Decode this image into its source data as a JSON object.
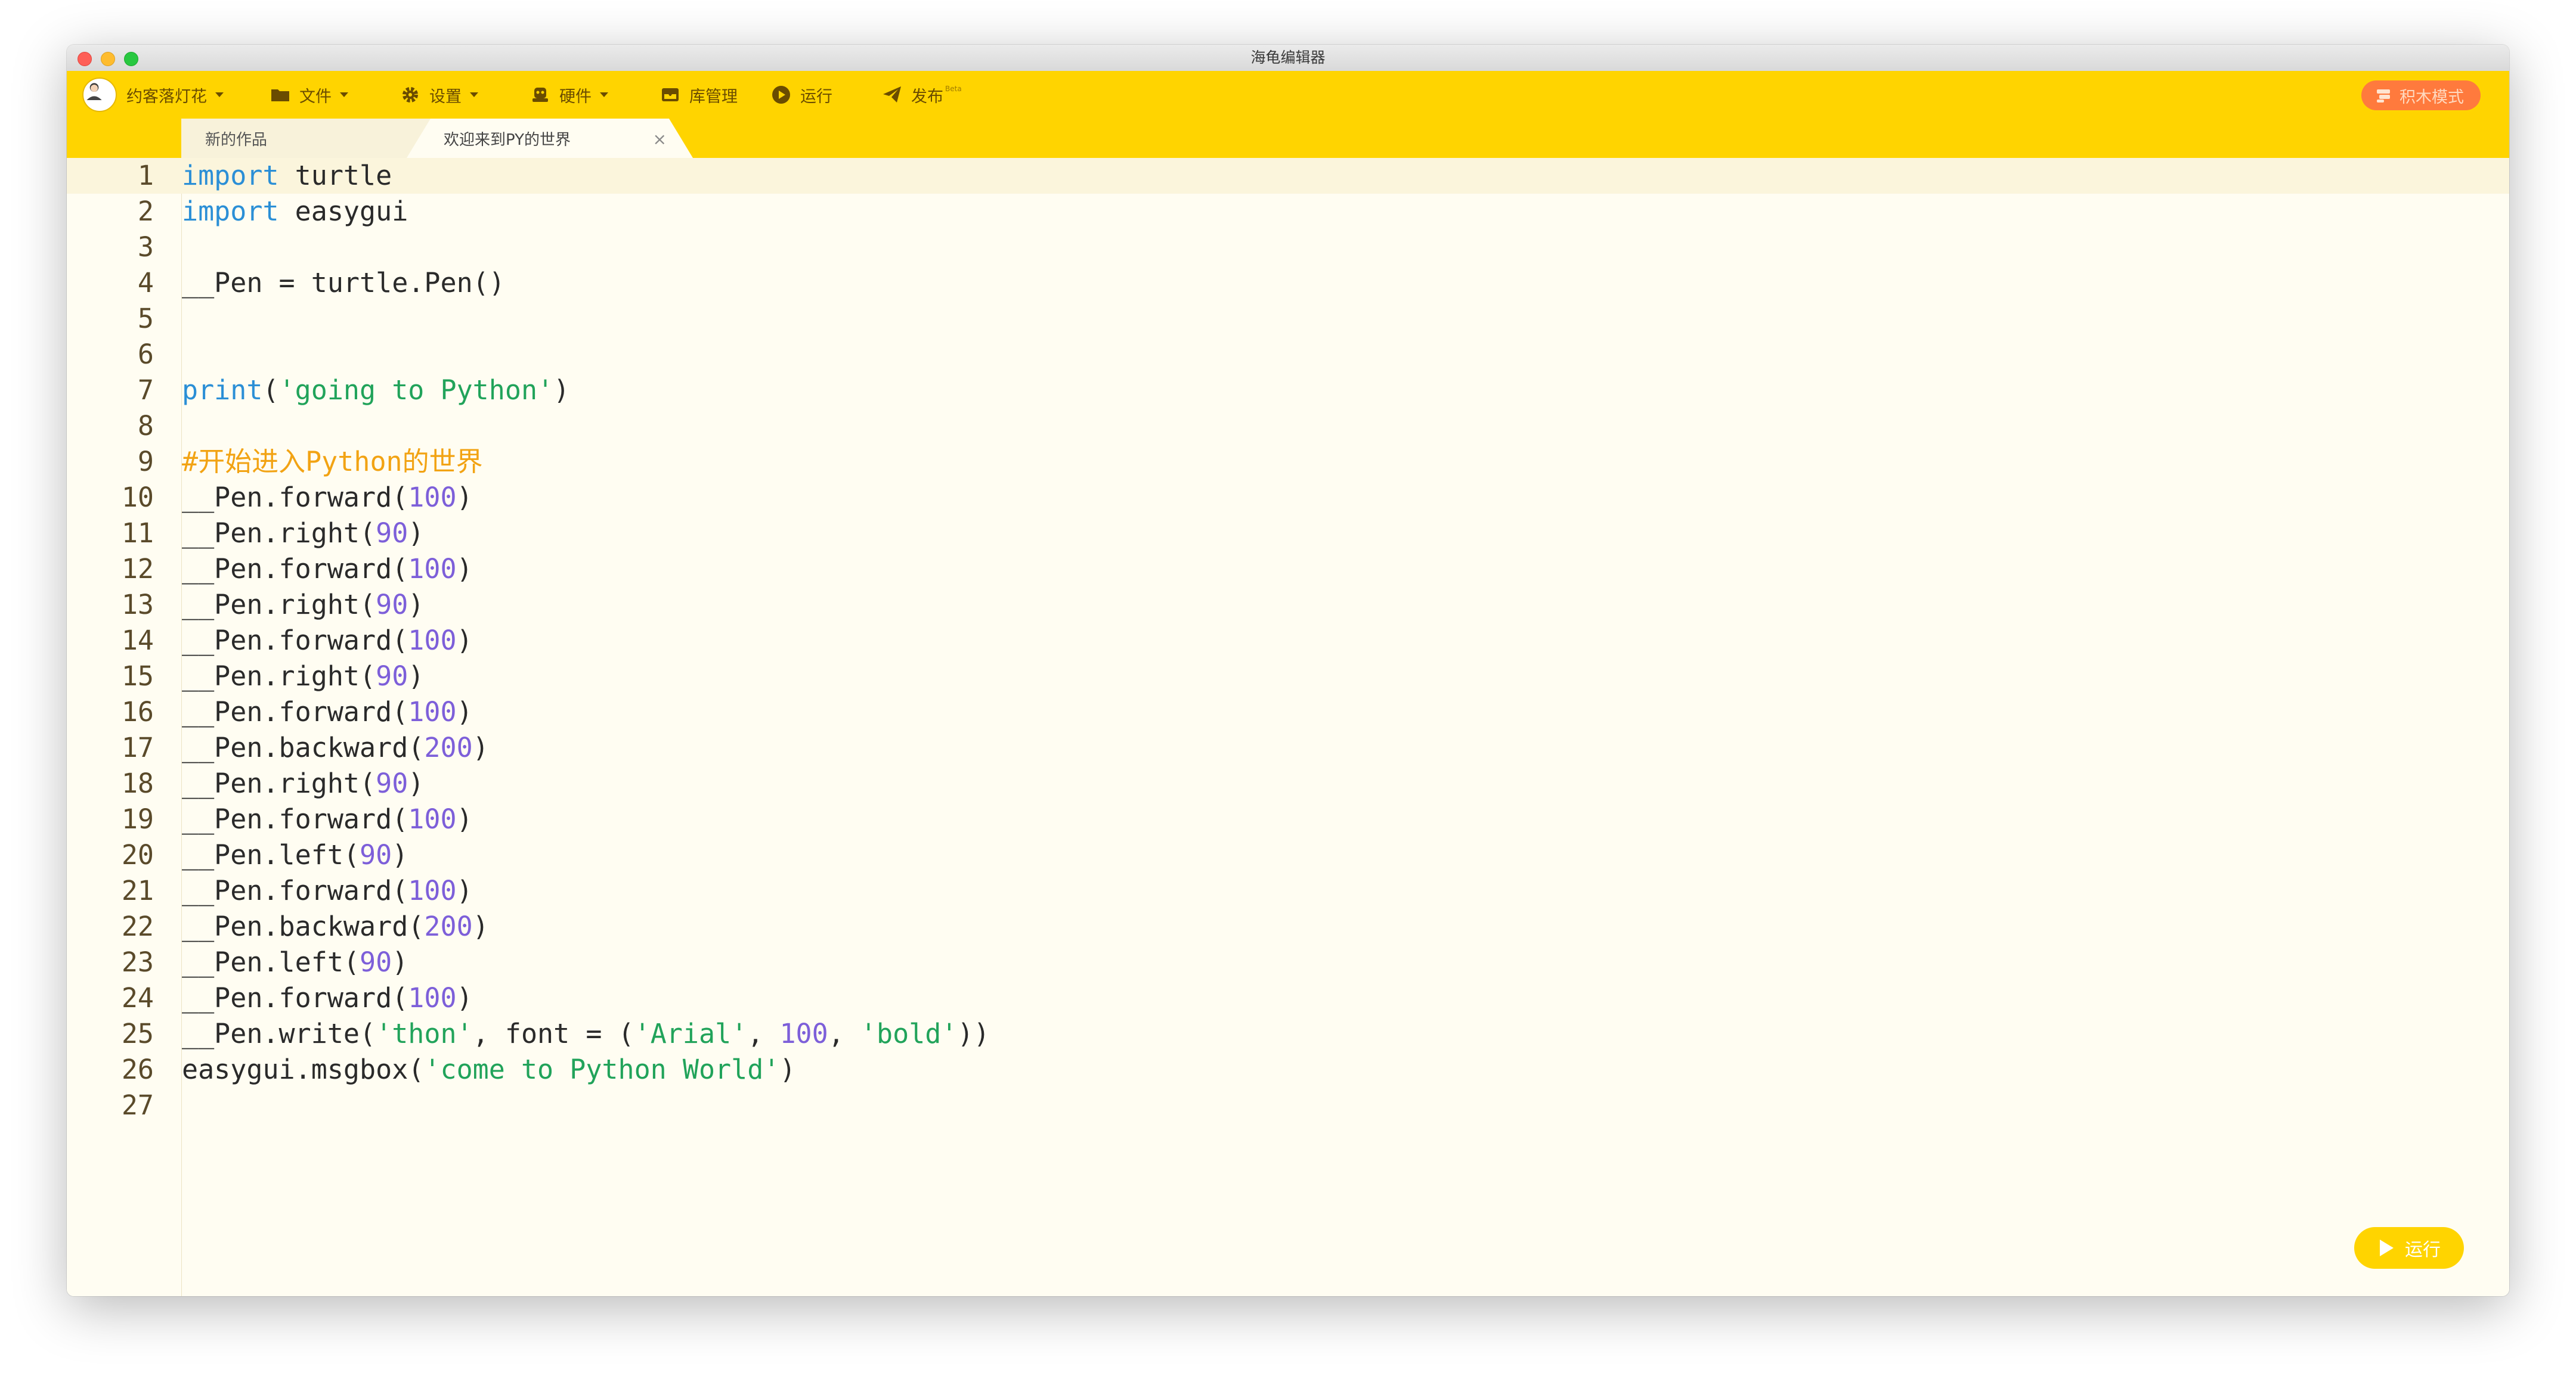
{
  "window": {
    "title": "海龟编辑器"
  },
  "toolbar": {
    "user": "约客落灯花",
    "file": "文件",
    "settings": "设置",
    "hardware": "硬件",
    "library": "库管理",
    "run": "运行",
    "publish": "发布",
    "publish_badge": "Beta",
    "blocks_mode": "积木模式"
  },
  "tabs": [
    {
      "label": "新的作品",
      "active": false
    },
    {
      "label": "欢迎来到PY的世界",
      "active": true
    }
  ],
  "editor": {
    "current_line": 1,
    "run_button": "运行",
    "lines": [
      [
        {
          "t": "kw",
          "v": "import"
        },
        {
          "t": "p",
          "v": " turtle"
        }
      ],
      [
        {
          "t": "kw",
          "v": "import"
        },
        {
          "t": "p",
          "v": " easygui"
        }
      ],
      [],
      [
        {
          "t": "p",
          "v": "__Pen = turtle.Pen()"
        }
      ],
      [],
      [],
      [
        {
          "t": "fn",
          "v": "print"
        },
        {
          "t": "p",
          "v": "("
        },
        {
          "t": "str",
          "v": "'going to Python'"
        },
        {
          "t": "p",
          "v": ")"
        }
      ],
      [],
      [
        {
          "t": "cm",
          "v": "#开始进入Python的世界"
        }
      ],
      [
        {
          "t": "p",
          "v": "__Pen.forward("
        },
        {
          "t": "num",
          "v": "100"
        },
        {
          "t": "p",
          "v": ")"
        }
      ],
      [
        {
          "t": "p",
          "v": "__Pen.right("
        },
        {
          "t": "num",
          "v": "90"
        },
        {
          "t": "p",
          "v": ")"
        }
      ],
      [
        {
          "t": "p",
          "v": "__Pen.forward("
        },
        {
          "t": "num",
          "v": "100"
        },
        {
          "t": "p",
          "v": ")"
        }
      ],
      [
        {
          "t": "p",
          "v": "__Pen.right("
        },
        {
          "t": "num",
          "v": "90"
        },
        {
          "t": "p",
          "v": ")"
        }
      ],
      [
        {
          "t": "p",
          "v": "__Pen.forward("
        },
        {
          "t": "num",
          "v": "100"
        },
        {
          "t": "p",
          "v": ")"
        }
      ],
      [
        {
          "t": "p",
          "v": "__Pen.right("
        },
        {
          "t": "num",
          "v": "90"
        },
        {
          "t": "p",
          "v": ")"
        }
      ],
      [
        {
          "t": "p",
          "v": "__Pen.forward("
        },
        {
          "t": "num",
          "v": "100"
        },
        {
          "t": "p",
          "v": ")"
        }
      ],
      [
        {
          "t": "p",
          "v": "__Pen.backward("
        },
        {
          "t": "num",
          "v": "200"
        },
        {
          "t": "p",
          "v": ")"
        }
      ],
      [
        {
          "t": "p",
          "v": "__Pen.right("
        },
        {
          "t": "num",
          "v": "90"
        },
        {
          "t": "p",
          "v": ")"
        }
      ],
      [
        {
          "t": "p",
          "v": "__Pen.forward("
        },
        {
          "t": "num",
          "v": "100"
        },
        {
          "t": "p",
          "v": ")"
        }
      ],
      [
        {
          "t": "p",
          "v": "__Pen.left("
        },
        {
          "t": "num",
          "v": "90"
        },
        {
          "t": "p",
          "v": ")"
        }
      ],
      [
        {
          "t": "p",
          "v": "__Pen.forward("
        },
        {
          "t": "num",
          "v": "100"
        },
        {
          "t": "p",
          "v": ")"
        }
      ],
      [
        {
          "t": "p",
          "v": "__Pen.backward("
        },
        {
          "t": "num",
          "v": "200"
        },
        {
          "t": "p",
          "v": ")"
        }
      ],
      [
        {
          "t": "p",
          "v": "__Pen.left("
        },
        {
          "t": "num",
          "v": "90"
        },
        {
          "t": "p",
          "v": ")"
        }
      ],
      [
        {
          "t": "p",
          "v": "__Pen.forward("
        },
        {
          "t": "num",
          "v": "100"
        },
        {
          "t": "p",
          "v": ")"
        }
      ],
      [
        {
          "t": "p",
          "v": "__Pen.write("
        },
        {
          "t": "str",
          "v": "'thon'"
        },
        {
          "t": "p",
          "v": ", font = ("
        },
        {
          "t": "str",
          "v": "'Arial'"
        },
        {
          "t": "p",
          "v": ", "
        },
        {
          "t": "num",
          "v": "100"
        },
        {
          "t": "p",
          "v": ", "
        },
        {
          "t": "str",
          "v": "'bold'"
        },
        {
          "t": "p",
          "v": "))"
        }
      ],
      [
        {
          "t": "p",
          "v": "easygui.msgbox("
        },
        {
          "t": "str",
          "v": "'come to Python World'"
        },
        {
          "t": "p",
          "v": ")"
        }
      ],
      []
    ]
  },
  "colors": {
    "toolbar_bg": "#ffd400",
    "editor_bg": "#fffdf2",
    "keyword": "#2b8fd6",
    "string": "#21a35a",
    "number": "#7d5fd9",
    "comment": "#f2a313",
    "blocks_button": "#ff7a3d"
  }
}
